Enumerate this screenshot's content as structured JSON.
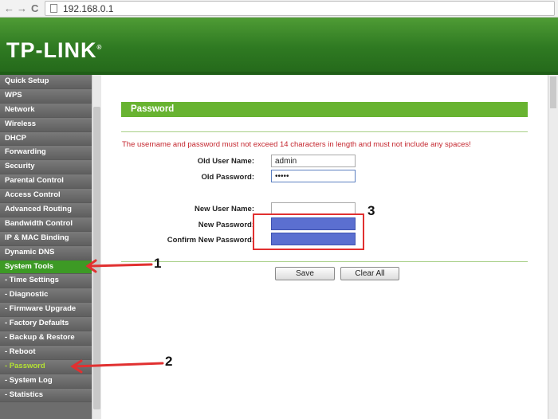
{
  "browser": {
    "back_glyph": "←",
    "forward_glyph": "→",
    "reload_glyph": "C",
    "url": "192.168.0.1"
  },
  "header": {
    "logo": "TP-LINK",
    "logo_mark": "®"
  },
  "sidebar": {
    "items": [
      {
        "label": "Quick Setup"
      },
      {
        "label": "WPS"
      },
      {
        "label": "Network"
      },
      {
        "label": "Wireless"
      },
      {
        "label": "DHCP"
      },
      {
        "label": "Forwarding"
      },
      {
        "label": "Security"
      },
      {
        "label": "Parental Control"
      },
      {
        "label": "Access Control"
      },
      {
        "label": "Advanced Routing"
      },
      {
        "label": "Bandwidth Control"
      },
      {
        "label": "IP & MAC Binding"
      },
      {
        "label": "Dynamic DNS"
      },
      {
        "label": "System Tools"
      },
      {
        "label": "- Time Settings"
      },
      {
        "label": "- Diagnostic"
      },
      {
        "label": "- Firmware Upgrade"
      },
      {
        "label": "- Factory Defaults"
      },
      {
        "label": "- Backup & Restore"
      },
      {
        "label": "- Reboot"
      },
      {
        "label": "- Password"
      },
      {
        "label": "- System Log"
      },
      {
        "label": "- Statistics"
      }
    ]
  },
  "main": {
    "title": "Password",
    "warning": "The username and password must not exceed 14 characters in length and must not include any spaces!",
    "old_user_label": "Old User Name:",
    "old_user_value": "admin",
    "old_password_label": "Old Password:",
    "old_password_value": "•••••",
    "new_user_label": "New User Name:",
    "new_user_value": "",
    "new_password_label": "New Password:",
    "confirm_password_label": "Confirm New Password:",
    "save_label": "Save",
    "clear_label": "Clear All"
  },
  "annotations": {
    "n1": "1",
    "n2": "2",
    "n3": "3",
    "color": "#e13030"
  }
}
